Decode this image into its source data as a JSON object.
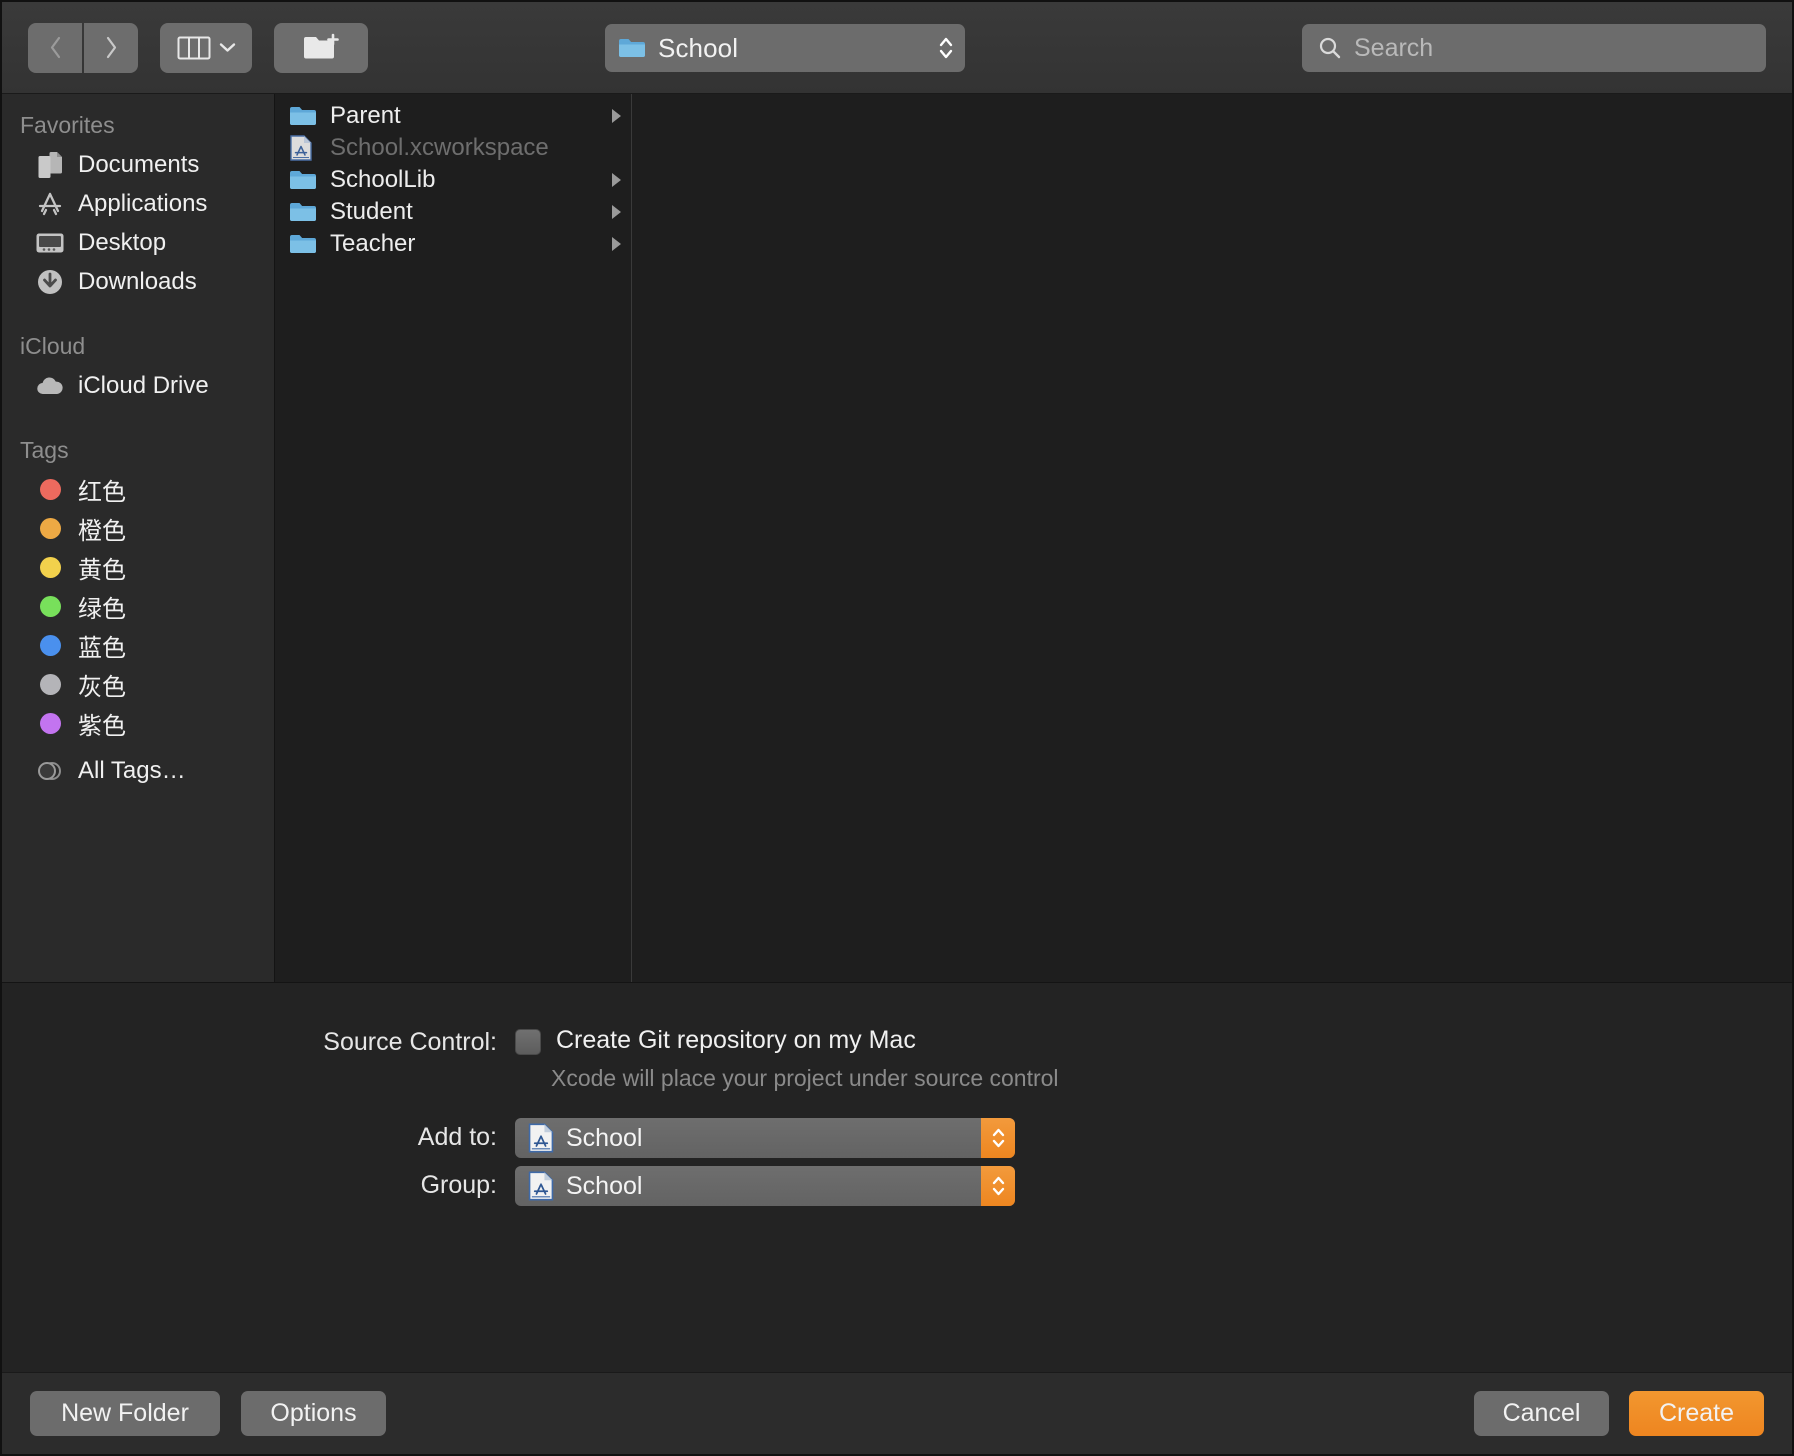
{
  "toolbar": {
    "back_icon": "chevron-left-icon",
    "forward_icon": "chevron-right-icon",
    "view_icon": "column-view-icon",
    "new_folder_icon": "new-folder-icon",
    "path_label": "School",
    "search_placeholder": "Search",
    "search_value": ""
  },
  "sidebar": {
    "sections": [
      {
        "title": "Favorites",
        "items": [
          {
            "label": "Documents",
            "icon": "documents-icon"
          },
          {
            "label": "Applications",
            "icon": "applications-icon"
          },
          {
            "label": "Desktop",
            "icon": "desktop-icon"
          },
          {
            "label": "Downloads",
            "icon": "downloads-icon"
          }
        ]
      },
      {
        "title": "iCloud",
        "items": [
          {
            "label": "iCloud Drive",
            "icon": "icloud-drive-icon"
          }
        ]
      },
      {
        "title": "Tags",
        "items": [
          {
            "label": "红色",
            "icon": "tag-dot-icon",
            "color": "#ED6A5E"
          },
          {
            "label": "橙色",
            "icon": "tag-dot-icon",
            "color": "#EDA944"
          },
          {
            "label": "黄色",
            "icon": "tag-dot-icon",
            "color": "#F2D14C"
          },
          {
            "label": "绿色",
            "icon": "tag-dot-icon",
            "color": "#78E05B"
          },
          {
            "label": "蓝色",
            "icon": "tag-dot-icon",
            "color": "#4A90EE"
          },
          {
            "label": "灰色",
            "icon": "tag-dot-icon",
            "color": "#B4B4B8"
          },
          {
            "label": "紫色",
            "icon": "tag-dot-icon",
            "color": "#C374F0"
          },
          {
            "label": "All Tags…",
            "icon": "all-tags-icon",
            "color": ""
          }
        ]
      }
    ]
  },
  "file_list": {
    "rows": [
      {
        "name": "Parent",
        "icon": "folder-icon",
        "has_arrow": true,
        "disabled": false
      },
      {
        "name": "School.xcworkspace",
        "icon": "xcode-workspace-icon",
        "has_arrow": false,
        "disabled": true
      },
      {
        "name": "SchoolLib",
        "icon": "folder-icon",
        "has_arrow": true,
        "disabled": false
      },
      {
        "name": "Student",
        "icon": "folder-icon",
        "has_arrow": true,
        "disabled": false
      },
      {
        "name": "Teacher",
        "icon": "folder-icon",
        "has_arrow": true,
        "disabled": false
      }
    ]
  },
  "accessory": {
    "source_control_label": "Source Control:",
    "git_checkbox_label": "Create Git repository on my Mac",
    "git_checkbox_checked": false,
    "source_control_hint": "Xcode will place your project under source control",
    "add_to_label": "Add to:",
    "add_to_value": "School",
    "group_label": "Group:",
    "group_value": "School"
  },
  "buttons": {
    "new_folder": "New Folder",
    "options": "Options",
    "cancel": "Cancel",
    "create": "Create"
  },
  "colors": {
    "accent": "#EE8620",
    "folder_blue": "#6DAFDC",
    "window_bg": "#232323",
    "sidebar_bg": "#2A2A2A"
  }
}
